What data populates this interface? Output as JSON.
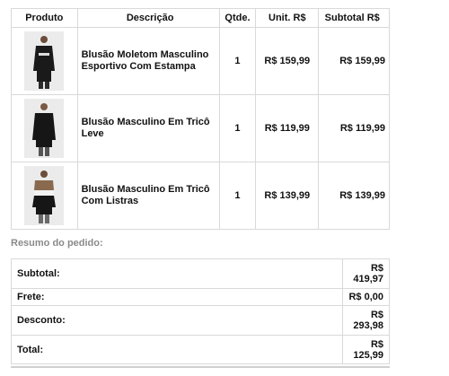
{
  "table": {
    "headers": {
      "product": "Produto",
      "description": "Descrição",
      "qty": "Qtde.",
      "unit": "Unit. R$",
      "subtotal": "Subtotal R$"
    },
    "rows": [
      {
        "description": "Blusão Moletom Masculino Esportivo Com Estampa",
        "qty": "1",
        "unit": "R$ 159,99",
        "subtotal": "R$ 159,99",
        "image_icon": "black-sweatshirt-print"
      },
      {
        "description": "Blusão Masculino Em Tricô Leve",
        "qty": "1",
        "unit": "R$ 119,99",
        "subtotal": "R$ 119,99",
        "image_icon": "black-knit-sweater"
      },
      {
        "description": "Blusão Masculino Em Tricô Com Listras",
        "qty": "1",
        "unit": "R$ 139,99",
        "subtotal": "R$ 139,99",
        "image_icon": "striped-knit-sweater"
      }
    ]
  },
  "summary": {
    "title": "Resumo do pedido:",
    "subtotal_label": "Subtotal:",
    "subtotal_value": "R$ 419,97",
    "frete_label": "Frete:",
    "frete_value": "R$ 0,00",
    "desconto_label": "Desconto:",
    "desconto_value": "R$ 293,98",
    "total_label": "Total:",
    "total_value": "R$ 125,99"
  },
  "colors": {
    "border": "#d9d9d9",
    "muted_text": "#8a8a8a",
    "photo_bg": "#ebebeb",
    "garment_black": "#1a1a1a",
    "stripe_brown": "#8a6a4f"
  }
}
